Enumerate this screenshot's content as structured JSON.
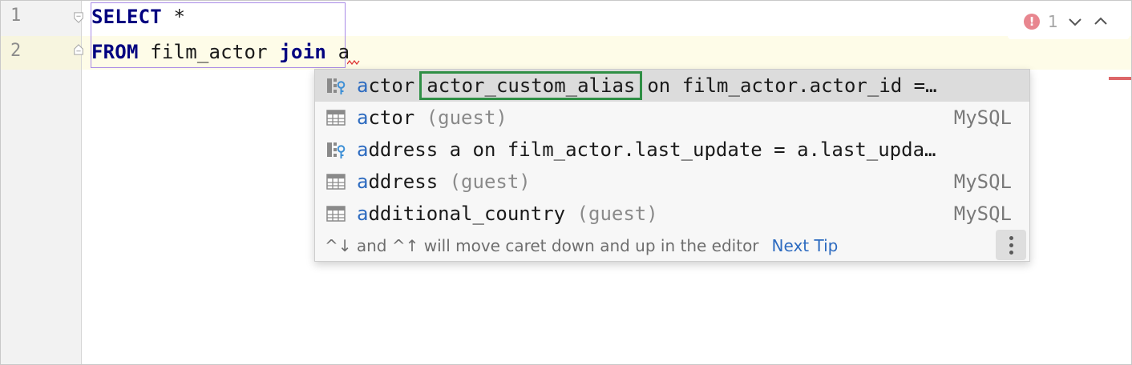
{
  "editor": {
    "line_numbers": [
      "1",
      "2"
    ],
    "line1": {
      "keyword": "SELECT",
      "rest": " *"
    },
    "line2": {
      "keyword": "FROM",
      "mid": " film_actor ",
      "keyword2": "join",
      "rest": " a"
    }
  },
  "inspection": {
    "count": "1",
    "icons": [
      "error-icon",
      "chevron-down-icon",
      "chevron-up-icon"
    ]
  },
  "completion": {
    "items": [
      {
        "icon": "join-clause-icon",
        "match": "a",
        "rest": "ctor",
        "alias": "actor_custom_alias",
        "tail": "on film_actor.actor_id =…",
        "right": ""
      },
      {
        "icon": "table-icon",
        "match": "a",
        "rest": "ctor",
        "hint": " (guest)",
        "right": "MySQL"
      },
      {
        "icon": "join-clause-icon",
        "match": "a",
        "rest": "ddress a on film_actor.last_update = a.last_upda…",
        "right": ""
      },
      {
        "icon": "table-icon",
        "match": "a",
        "rest": "ddress",
        "hint": " (guest)",
        "right": "MySQL"
      },
      {
        "icon": "table-icon",
        "match": "a",
        "rest": "dditional_country",
        "hint": " (guest)",
        "right": "MySQL"
      }
    ],
    "tip": "^↓ and ^↑ will move caret down and up in the editor",
    "next_tip": "Next Tip",
    "menu_icon": "kebab-menu-icon"
  },
  "colors": {
    "keyword": "#000080",
    "match": "#2d6bc0",
    "alias_border": "#2f8f45",
    "selection_border": "#a98be6",
    "error": "#dd6668",
    "caret_line": "#fefce8"
  }
}
